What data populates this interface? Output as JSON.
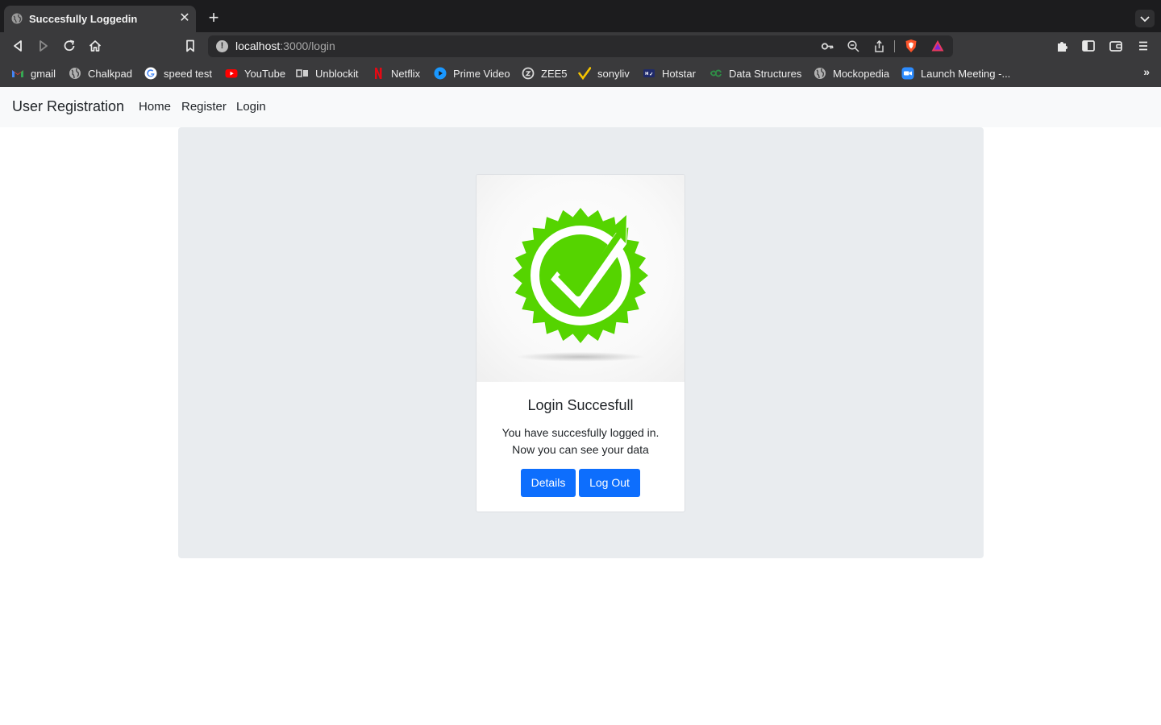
{
  "browser": {
    "tab_title": "Succesfully Loggedin",
    "url_host": "localhost",
    "url_path": ":3000/login",
    "bookmarks": [
      {
        "label": "gmail",
        "icon": "gmail-icon"
      },
      {
        "label": "Chalkpad",
        "icon": "globe-icon"
      },
      {
        "label": "speed test",
        "icon": "google-icon"
      },
      {
        "label": "YouTube",
        "icon": "youtube-icon"
      },
      {
        "label": "Unblockit",
        "icon": "unblockit-icon"
      },
      {
        "label": "Netflix",
        "icon": "netflix-icon"
      },
      {
        "label": "Prime Video",
        "icon": "prime-video-icon"
      },
      {
        "label": "ZEE5",
        "icon": "zee5-icon"
      },
      {
        "label": "sonyliv",
        "icon": "sonyliv-icon"
      },
      {
        "label": "Hotstar",
        "icon": "hotstar-icon"
      },
      {
        "label": "Data Structures",
        "icon": "data-structures-icon"
      },
      {
        "label": "Mockopedia",
        "icon": "globe-icon"
      },
      {
        "label": "Launch Meeting -...",
        "icon": "zoom-icon"
      }
    ]
  },
  "navbar": {
    "brand": "User Registration",
    "links": [
      "Home",
      "Register",
      "Login"
    ]
  },
  "card": {
    "title": "Login Succesfull",
    "text_line1": "You have succesfully logged in.",
    "text_line2": "Now you can see your data",
    "details_label": "Details",
    "logout_label": "Log Out"
  },
  "colors": {
    "primary_button": "#0d6efd",
    "success_badge": "#55d400",
    "navbar_bg": "#f8f9fa",
    "jumbotron_bg": "#e9ecef"
  }
}
